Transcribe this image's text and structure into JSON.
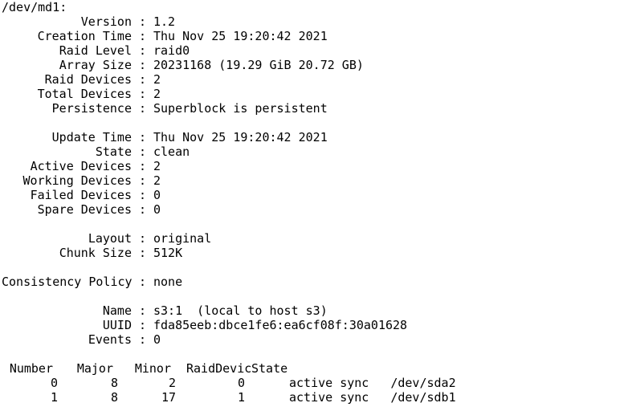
{
  "device": "/dev/md1:",
  "fields_a": [
    {
      "label": "Version",
      "value": "1.2"
    },
    {
      "label": "Creation Time",
      "value": "Thu Nov 25 19:20:42 2021"
    },
    {
      "label": "Raid Level",
      "value": "raid0"
    },
    {
      "label": "Array Size",
      "value": "20231168 (19.29 GiB 20.72 GB)"
    },
    {
      "label": "Raid Devices",
      "value": "2"
    },
    {
      "label": "Total Devices",
      "value": "2"
    },
    {
      "label": "Persistence",
      "value": "Superblock is persistent"
    }
  ],
  "fields_b": [
    {
      "label": "Update Time",
      "value": "Thu Nov 25 19:20:42 2021"
    },
    {
      "label": "State",
      "value": "clean"
    },
    {
      "label": "Active Devices",
      "value": "2"
    },
    {
      "label": "Working Devices",
      "value": "2"
    },
    {
      "label": "Failed Devices",
      "value": "0"
    },
    {
      "label": "Spare Devices",
      "value": "0"
    }
  ],
  "fields_c": [
    {
      "label": "Layout",
      "value": "original"
    },
    {
      "label": "Chunk Size",
      "value": "512K"
    }
  ],
  "fields_d": [
    {
      "label": "Consistency Policy",
      "value": "none"
    }
  ],
  "fields_e": [
    {
      "label": "Name",
      "value": "s3:1  (local to host s3)"
    },
    {
      "label": "UUID",
      "value": "fda85eeb:dbce1fe6:ea6cf08f:30a01628"
    },
    {
      "label": "Events",
      "value": "0"
    }
  ],
  "separator": ":",
  "table": {
    "headers": {
      "number": "Number",
      "major": "Major",
      "minor": "Minor",
      "raiddevice": "RaidDevice",
      "state": "State"
    },
    "rows": [
      {
        "number": "0",
        "major": "8",
        "minor": "2",
        "raiddevice": "0",
        "state": "active sync",
        "device": "/dev/sda2"
      },
      {
        "number": "1",
        "major": "8",
        "minor": "17",
        "raiddevice": "1",
        "state": "active sync",
        "device": "/dev/sdb1"
      }
    ]
  }
}
